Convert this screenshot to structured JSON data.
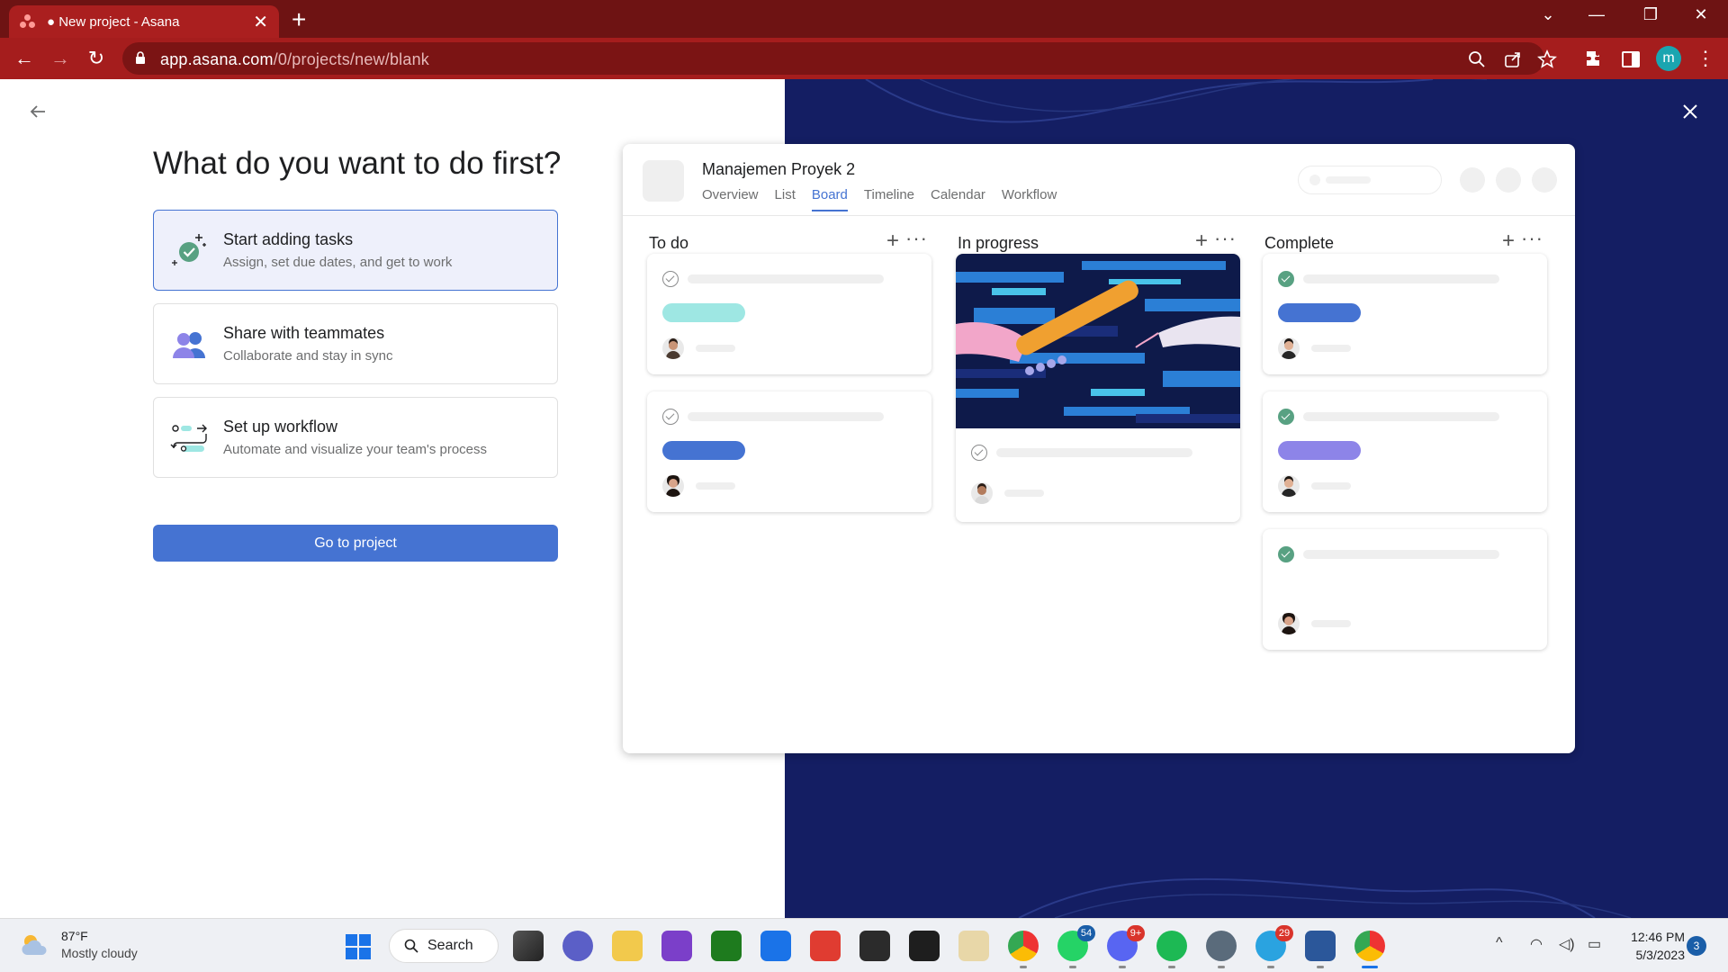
{
  "browser": {
    "tab_title": "● New project - Asana",
    "url_host": "app.asana.com",
    "url_path": "/0/projects/new/blank",
    "profile_initial": "m",
    "accent": "#a51d1d"
  },
  "setup": {
    "heading": "What do you want to do first?",
    "options": [
      {
        "title": "Start adding tasks",
        "subtitle": "Assign, set due dates, and get to work",
        "icon": "tasks-sparkle-icon",
        "selected": true
      },
      {
        "title": "Share with teammates",
        "subtitle": "Collaborate and stay in sync",
        "icon": "teammates-icon",
        "selected": false
      },
      {
        "title": "Set up workflow",
        "subtitle": "Automate and visualize your team's process",
        "icon": "workflow-icon",
        "selected": false
      }
    ],
    "go_button": "Go to project",
    "button_color": "#4573d2"
  },
  "preview": {
    "project_name": "Manajemen Proyek 2",
    "tabs": [
      "Overview",
      "List",
      "Board",
      "Timeline",
      "Calendar",
      "Workflow"
    ],
    "active_tab": "Board",
    "columns": [
      {
        "title": "To do"
      },
      {
        "title": "In progress"
      },
      {
        "title": "Complete"
      }
    ],
    "pill_colors": {
      "teal": "#9ee7e3",
      "blue": "#4573d2",
      "purple": "#8d84e8"
    }
  },
  "taskbar": {
    "weather_temp": "87°F",
    "weather_desc": "Mostly cloudy",
    "search_label": "Search",
    "badges": {
      "whatsapp": "54",
      "discord": "9+",
      "telegram": "29"
    },
    "time": "12:46 PM",
    "date": "5/3/2023",
    "notifications": "3"
  }
}
